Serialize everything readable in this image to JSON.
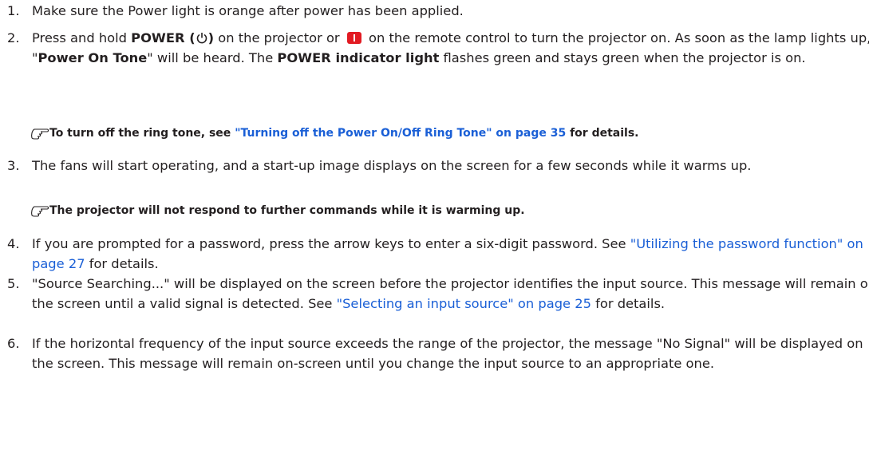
{
  "steps": [
    {
      "num": "1.",
      "text": "Make sure the Power light is orange after power has been applied."
    },
    {
      "num": "2.",
      "a": "Press and hold ",
      "power_bold": "POWER (",
      "power_close": ")",
      "b": " on the projector or ",
      "c": " on the remote control to turn the projector on. As soon as the lamp lights up, a \"",
      "tone_bold": "Power On Tone",
      "d": "\" will be heard. The ",
      "indicator_bold": "POWER indicator light",
      "e": " flashes green and stays green when the projector is on."
    },
    {
      "num": "3.",
      "text": "The fans will start operating, and a start-up image displays on the screen for a few seconds while it warms up."
    },
    {
      "num": "4.",
      "a": "If you are prompted for a password, press the arrow keys to enter a six-digit password. See ",
      "link": "\"Utilizing the password function\" on page 27",
      "b": " for details."
    },
    {
      "num": "5.",
      "a": "\"Source Searching...\" will be displayed on the screen before the projector identifies the input source. This message will remain on the screen until a valid signal is detected. See ",
      "link": "\"Selecting an input source\" on page 25",
      "b": " for details."
    },
    {
      "num": "6.",
      "text": "If the horizontal frequency of the input source exceeds the range of the projector, the message \"No Signal\" will be displayed on the screen. This message will remain on-screen until you change the input source to an appropriate one."
    }
  ],
  "notes": [
    {
      "a": "To turn off the ring tone, see ",
      "link": "\"Turning off the Power On/Off Ring Tone\" on page 35",
      "b": " for details."
    },
    {
      "text": "The projector will not respond to further commands while it is warming up."
    }
  ],
  "colors": {
    "link": "#1a5fd6",
    "remote_button": "#e21b23",
    "text": "#231f20"
  },
  "icons": {
    "note": "pointing-hand-icon",
    "power": "power-icon",
    "remote": "remote-power-button-icon"
  }
}
